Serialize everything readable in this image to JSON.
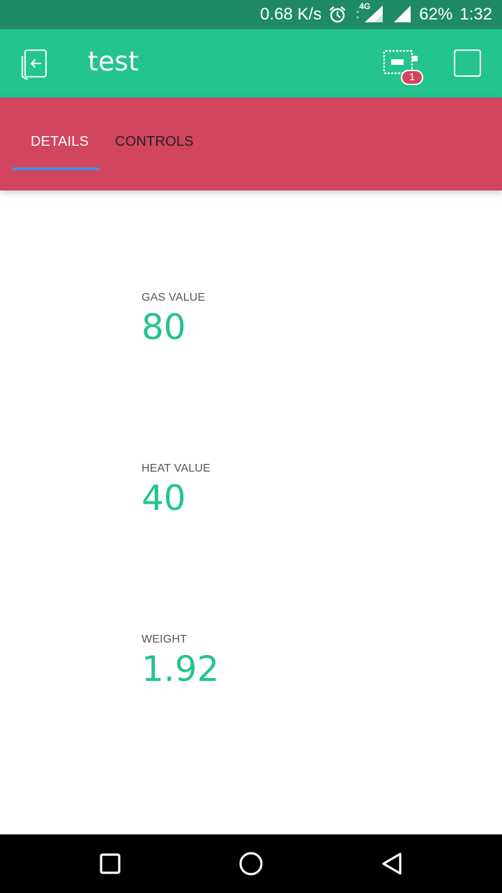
{
  "status_bar": {
    "net_speed": "0.68 K/s",
    "network_type": "4G",
    "battery": "62%",
    "time": "1:32",
    "icons": [
      "alarm-icon",
      "signal-icon",
      "battery-icon"
    ]
  },
  "app_bar": {
    "title": "test",
    "device_badge_count": "1",
    "icons": [
      "back-exit-icon",
      "device-icon",
      "square-icon"
    ]
  },
  "tabs": [
    {
      "label": "DETAILS",
      "active": true
    },
    {
      "label": "CONTROLS",
      "active": false
    }
  ],
  "values": [
    {
      "label": "GAS VALUE",
      "value": "80"
    },
    {
      "label": "HEAT VALUE",
      "value": "40"
    },
    {
      "label": "WEIGHT",
      "value": "1.92"
    }
  ],
  "nav_bar": {
    "icons": [
      "recents-icon",
      "home-icon",
      "back-icon"
    ]
  },
  "colors": {
    "status_bar": "#1f8a66",
    "app_bar": "#23c48e",
    "tab_bar": "#d1455f",
    "tab_indicator": "#4a90d9",
    "value_text": "#23c48e",
    "badge": "#d3435c"
  }
}
